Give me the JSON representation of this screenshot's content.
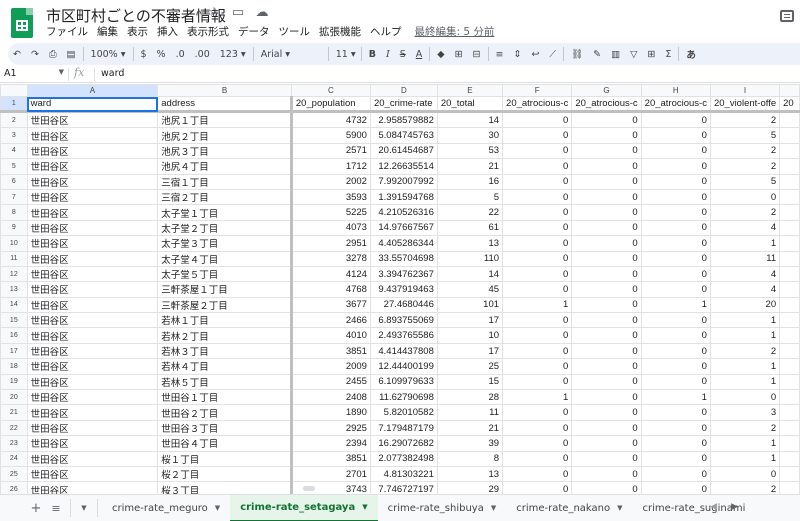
{
  "app": {
    "title": "市区町村ごとの不審者情報",
    "title_icons": [
      "star-icon",
      "move-folder-icon",
      "cloud-status-icon"
    ],
    "menu": [
      "ファイル",
      "編集",
      "表示",
      "挿入",
      "表示形式",
      "データ",
      "ツール",
      "拡張機能",
      "ヘルプ"
    ],
    "last_edit": "最終編集: 5 分前"
  },
  "toolbar": {
    "undo": "↶",
    "redo": "↷",
    "print": "⎙",
    "paint_format": "▤",
    "zoom": "100%",
    "currency": "$",
    "percent": "%",
    "decrease_decimal": ".0",
    "increase_decimal": ".00",
    "more_formats": "123",
    "font": "Arial",
    "font_size": "11",
    "bold": "B",
    "italic": "I",
    "strikethrough": "S",
    "text_color": "A",
    "fill_color": "◆",
    "borders": "⊞",
    "merge": "⊟",
    "h_align": "≡",
    "v_align": "⇕",
    "wrap": "↩",
    "rotate": "⟋",
    "link": "⛓",
    "comment": "✎",
    "chart": "▥",
    "filter": "▽",
    "views": "⊞",
    "functions": "Σ",
    "input_tools": "あ"
  },
  "formula_bar": {
    "cell_ref": "A1",
    "fx": "fx",
    "value": "ward"
  },
  "columns": [
    "A",
    "B",
    "C",
    "D",
    "E",
    "F",
    "G",
    "H",
    "I"
  ],
  "header_row": [
    "ward",
    "address",
    "20_population",
    "20_crime-rate",
    "20_total",
    "20_atrocious-c",
    "20_atrocious-c",
    "20_atrocious-c",
    "20_violent-offe",
    "20"
  ],
  "rows": [
    {
      "n": "2",
      "cells": [
        "世田谷区",
        "池尻１丁目",
        "4732",
        "2.958579882",
        "14",
        "0",
        "0",
        "0",
        "2"
      ]
    },
    {
      "n": "3",
      "cells": [
        "世田谷区",
        "池尻２丁目",
        "5900",
        "5.084745763",
        "30",
        "0",
        "0",
        "0",
        "5"
      ]
    },
    {
      "n": "4",
      "cells": [
        "世田谷区",
        "池尻３丁目",
        "2571",
        "20.61454687",
        "53",
        "0",
        "0",
        "0",
        "2"
      ]
    },
    {
      "n": "5",
      "cells": [
        "世田谷区",
        "池尻４丁目",
        "1712",
        "12.26635514",
        "21",
        "0",
        "0",
        "0",
        "2"
      ]
    },
    {
      "n": "6",
      "cells": [
        "世田谷区",
        "三宿１丁目",
        "2002",
        "7.992007992",
        "16",
        "0",
        "0",
        "0",
        "5"
      ]
    },
    {
      "n": "7",
      "cells": [
        "世田谷区",
        "三宿２丁目",
        "3593",
        "1.391594768",
        "5",
        "0",
        "0",
        "0",
        "0"
      ]
    },
    {
      "n": "8",
      "cells": [
        "世田谷区",
        "太子堂１丁目",
        "5225",
        "4.210526316",
        "22",
        "0",
        "0",
        "0",
        "2"
      ]
    },
    {
      "n": "9",
      "cells": [
        "世田谷区",
        "太子堂２丁目",
        "4073",
        "14.97667567",
        "61",
        "0",
        "0",
        "0",
        "4"
      ]
    },
    {
      "n": "10",
      "cells": [
        "世田谷区",
        "太子堂３丁目",
        "2951",
        "4.405286344",
        "13",
        "0",
        "0",
        "0",
        "1"
      ]
    },
    {
      "n": "11",
      "cells": [
        "世田谷区",
        "太子堂４丁目",
        "3278",
        "33.55704698",
        "110",
        "0",
        "0",
        "0",
        "11"
      ]
    },
    {
      "n": "12",
      "cells": [
        "世田谷区",
        "太子堂５丁目",
        "4124",
        "3.394762367",
        "14",
        "0",
        "0",
        "0",
        "4"
      ]
    },
    {
      "n": "13",
      "cells": [
        "世田谷区",
        "三軒茶屋１丁目",
        "4768",
        "9.437919463",
        "45",
        "0",
        "0",
        "0",
        "4"
      ]
    },
    {
      "n": "14",
      "cells": [
        "世田谷区",
        "三軒茶屋２丁目",
        "3677",
        "27.4680446",
        "101",
        "1",
        "0",
        "1",
        "20"
      ]
    },
    {
      "n": "15",
      "cells": [
        "世田谷区",
        "若林１丁目",
        "2466",
        "6.893755069",
        "17",
        "0",
        "0",
        "0",
        "1"
      ]
    },
    {
      "n": "16",
      "cells": [
        "世田谷区",
        "若林２丁目",
        "4010",
        "2.493765586",
        "10",
        "0",
        "0",
        "0",
        "1"
      ]
    },
    {
      "n": "17",
      "cells": [
        "世田谷区",
        "若林３丁目",
        "3851",
        "4.414437808",
        "17",
        "0",
        "0",
        "0",
        "2"
      ]
    },
    {
      "n": "18",
      "cells": [
        "世田谷区",
        "若林４丁目",
        "2009",
        "12.44400199",
        "25",
        "0",
        "0",
        "0",
        "1"
      ]
    },
    {
      "n": "19",
      "cells": [
        "世田谷区",
        "若林５丁目",
        "2455",
        "6.109979633",
        "15",
        "0",
        "0",
        "0",
        "1"
      ]
    },
    {
      "n": "20",
      "cells": [
        "世田谷区",
        "世田谷１丁目",
        "2408",
        "11.62790698",
        "28",
        "1",
        "0",
        "1",
        "0"
      ]
    },
    {
      "n": "21",
      "cells": [
        "世田谷区",
        "世田谷２丁目",
        "1890",
        "5.82010582",
        "11",
        "0",
        "0",
        "0",
        "3"
      ]
    },
    {
      "n": "22",
      "cells": [
        "世田谷区",
        "世田谷３丁目",
        "2925",
        "7.179487179",
        "21",
        "0",
        "0",
        "0",
        "2"
      ]
    },
    {
      "n": "23",
      "cells": [
        "世田谷区",
        "世田谷４丁目",
        "2394",
        "16.29072682",
        "39",
        "0",
        "0",
        "0",
        "1"
      ]
    },
    {
      "n": "24",
      "cells": [
        "世田谷区",
        "桜１丁目",
        "3851",
        "2.077382498",
        "8",
        "0",
        "0",
        "0",
        "1"
      ]
    },
    {
      "n": "25",
      "cells": [
        "世田谷区",
        "桜２丁目",
        "2701",
        "4.81303221",
        "13",
        "0",
        "0",
        "0",
        "0"
      ]
    },
    {
      "n": "26",
      "cells": [
        "世田谷区",
        "桜３丁目",
        "3743",
        "7.746727197",
        "29",
        "0",
        "0",
        "0",
        "2"
      ]
    }
  ],
  "tabs": {
    "add": "+",
    "all_sheets": "≡",
    "sheets": [
      {
        "label": "crime-rate_meguro",
        "active": false
      },
      {
        "label": "crime-rate_setagaya",
        "active": true
      },
      {
        "label": "crime-rate_shibuya",
        "active": false
      },
      {
        "label": "crime-rate_nakano",
        "active": false
      },
      {
        "label": "crime-rate_suginami",
        "active": false
      }
    ],
    "scroll_left": "◀",
    "scroll_right": "▶"
  }
}
